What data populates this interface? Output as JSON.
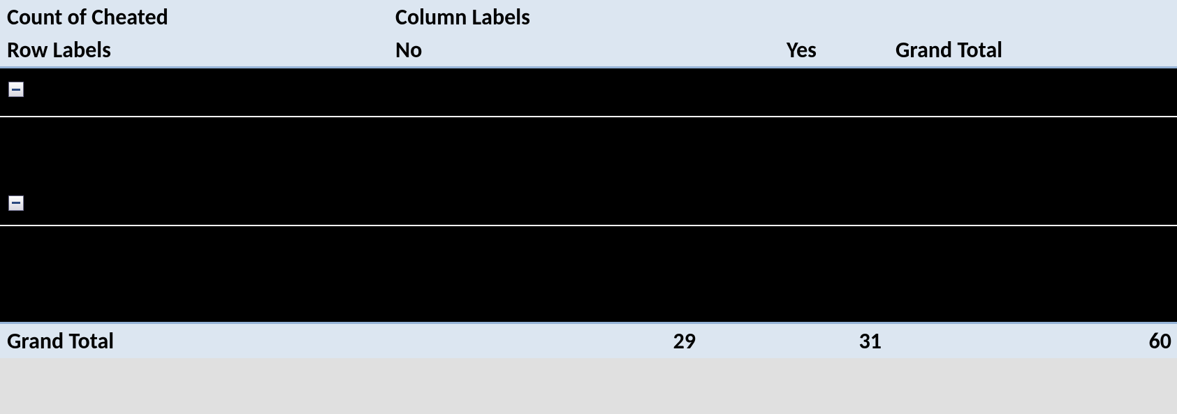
{
  "header": {
    "title": "Count of Cheated",
    "columnLabelsCaption": "Column Labels",
    "rowLabelsCaption": "Row Labels",
    "col_no": "No",
    "col_yes": "Yes",
    "col_grand_total": "Grand Total"
  },
  "footer": {
    "grand_total_label": "Grand Total",
    "total_no": "29",
    "total_yes": "31",
    "total_all": "60"
  }
}
